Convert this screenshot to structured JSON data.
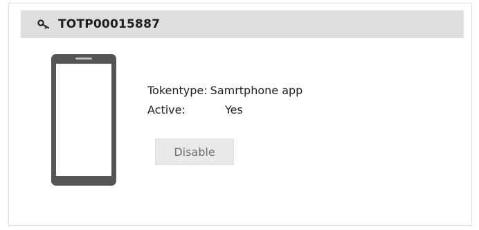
{
  "token": {
    "title": "TOTP00015887",
    "icon": "key-icon",
    "device_icon": "smartphone-icon"
  },
  "details": {
    "type_label": "Tokentype:",
    "type_value": "Samrtphone app",
    "active_label": "Active:",
    "active_value": "Yes"
  },
  "actions": {
    "disable_label": "Disable"
  },
  "colors": {
    "header_background": "#dedede",
    "phone_body": "#555555",
    "button_background": "#e9e9e9",
    "button_text": "#6d6d6d"
  }
}
